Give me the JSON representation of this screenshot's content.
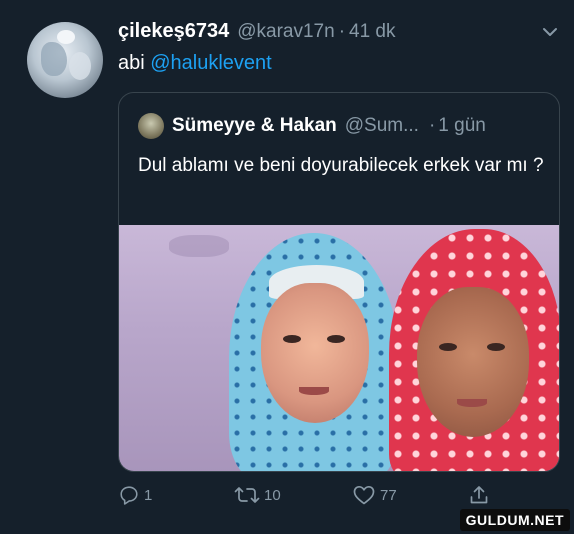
{
  "tweet": {
    "display_name": "çilekeş6734",
    "handle": "@karav17n",
    "separator": "·",
    "time": "41 dk",
    "text_prefix": "abi ",
    "mention": "@haluklevent"
  },
  "quote": {
    "display_name": "Sümeyye & Hakan",
    "handle": "@Sum...",
    "separator": "·",
    "time": "1 gün",
    "text": "Dul ablamı ve beni doyurabilecek erkek var mı ?"
  },
  "actions": {
    "reply_count": "1",
    "retweet_count": "10",
    "like_count": "77"
  },
  "watermark": "GULDUM.NET",
  "colors": {
    "background": "#15202b",
    "secondary_text": "#8899a6",
    "link": "#1da1f2",
    "border": "#38444d"
  },
  "icons": [
    "chevron-down-icon",
    "reply-icon",
    "retweet-icon",
    "like-icon",
    "share-icon"
  ]
}
